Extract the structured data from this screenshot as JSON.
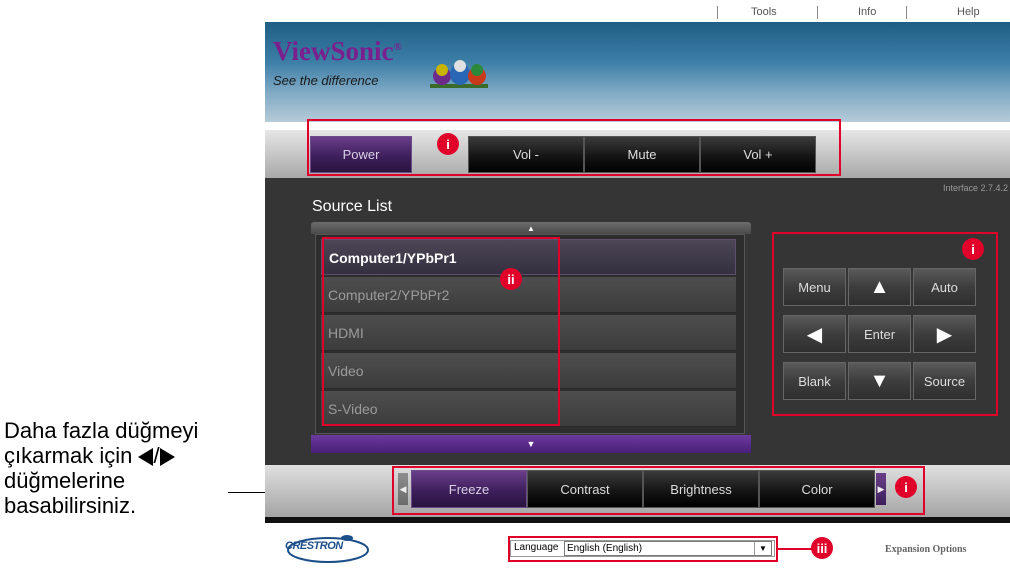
{
  "annotation": {
    "line1": "Daha fazla düğmeyi",
    "line2_prefix": "çıkarmak için",
    "line2_sep": "/",
    "line3": "düğmelerine",
    "line4": "basabilirsiniz."
  },
  "top_links": {
    "tools": "Tools",
    "info": "Info",
    "help": "Help"
  },
  "banner": {
    "logo": "ViewSonic",
    "tagline": "See the difference"
  },
  "toolbar": {
    "power": "Power",
    "vol_down": "Vol -",
    "mute": "Mute",
    "vol_up": "Vol +"
  },
  "version": "Interface 2.7.4.2",
  "source_list": {
    "title": "Source List",
    "up_arrow": "▲",
    "down_arrow": "▼",
    "items": [
      {
        "label": "Computer1/YPbPr1",
        "active": true
      },
      {
        "label": "Computer2/YPbPr2",
        "active": false
      },
      {
        "label": "HDMI",
        "active": false
      },
      {
        "label": "Video",
        "active": false
      },
      {
        "label": "S-Video",
        "active": false
      }
    ]
  },
  "keypad": {
    "menu": "Menu",
    "up": "▲",
    "auto": "Auto",
    "left": "◀",
    "enter": "Enter",
    "right": "▶",
    "blank": "Blank",
    "down": "▼",
    "source": "Source"
  },
  "bottom_toolbar": {
    "freeze": "Freeze",
    "contrast": "Contrast",
    "brightness": "Brightness",
    "color": "Color",
    "left_arrow": "◀",
    "right_arrow": "▶"
  },
  "footer": {
    "crestron": "CRESTRON",
    "language_label": "Language",
    "language_value": "English (English)",
    "expansion": "Expansion Options"
  },
  "badges": {
    "i": "i",
    "ii": "ii",
    "iii": "iii"
  },
  "colors": {
    "annotation_red": "#e0002a",
    "purple_active": "#3e1f5c",
    "panel_dark": "#353535",
    "logo_purple": "#7b1f8e"
  }
}
